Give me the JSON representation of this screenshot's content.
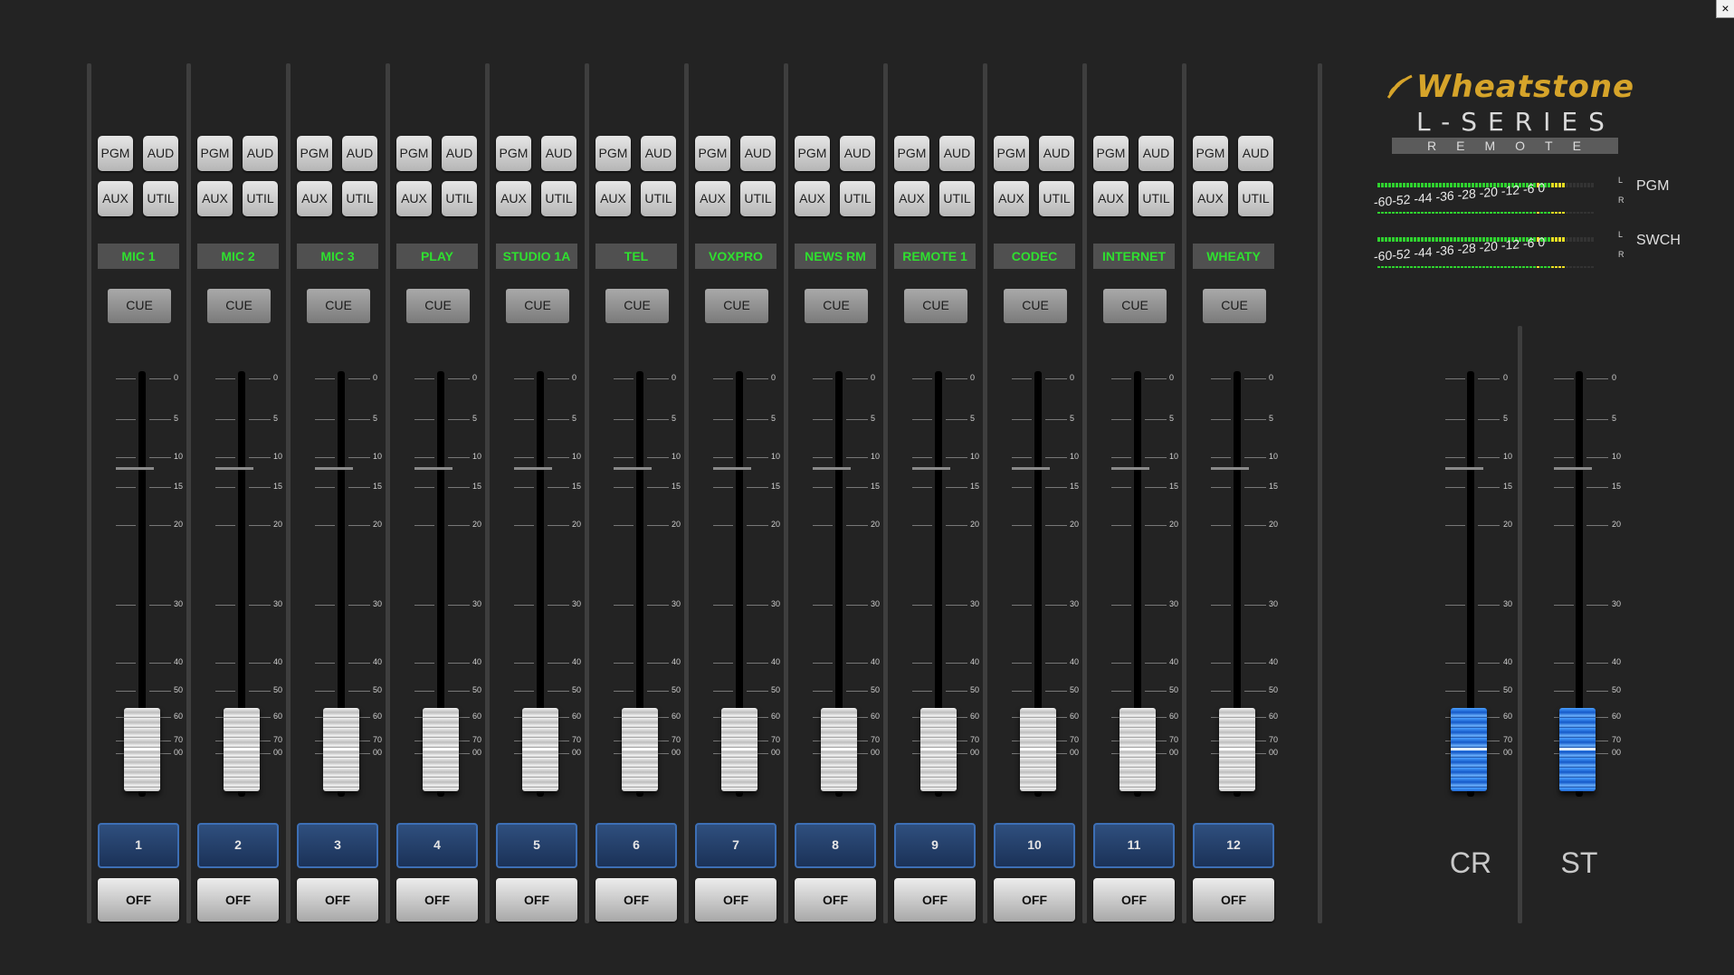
{
  "window": {
    "close_label": "×"
  },
  "logo": {
    "brand": "Wheatstone",
    "series": "L-SERIES",
    "subtitle": "REMOTE"
  },
  "meters": [
    {
      "name": "PGM",
      "scale": "-60-52 -44 -36 -28 -20 -12 -6 0",
      "left": "L",
      "right": "R"
    },
    {
      "name": "SWCH",
      "scale": "-60-52 -44 -36 -28 -20 -12 -6 0",
      "left": "L",
      "right": "R"
    }
  ],
  "fader_scale": [
    "0",
    "5",
    "10",
    "15",
    "20",
    "30",
    "40",
    "50",
    "60",
    "70",
    "00"
  ],
  "channels": [
    {
      "number": "1",
      "label": "MIC 1",
      "pgm": "PGM",
      "aud": "AUD",
      "aux": "AUX",
      "util": "UTIL",
      "cue": "CUE",
      "off": "OFF"
    },
    {
      "number": "2",
      "label": "MIC 2",
      "pgm": "PGM",
      "aud": "AUD",
      "aux": "AUX",
      "util": "UTIL",
      "cue": "CUE",
      "off": "OFF"
    },
    {
      "number": "3",
      "label": "MIC 3",
      "pgm": "PGM",
      "aud": "AUD",
      "aux": "AUX",
      "util": "UTIL",
      "cue": "CUE",
      "off": "OFF"
    },
    {
      "number": "4",
      "label": "PLAY",
      "pgm": "PGM",
      "aud": "AUD",
      "aux": "AUX",
      "util": "UTIL",
      "cue": "CUE",
      "off": "OFF"
    },
    {
      "number": "5",
      "label": "STUDIO 1A",
      "pgm": "PGM",
      "aud": "AUD",
      "aux": "AUX",
      "util": "UTIL",
      "cue": "CUE",
      "off": "OFF"
    },
    {
      "number": "6",
      "label": "TEL",
      "pgm": "PGM",
      "aud": "AUD",
      "aux": "AUX",
      "util": "UTIL",
      "cue": "CUE",
      "off": "OFF"
    },
    {
      "number": "7",
      "label": "VOXPRO",
      "pgm": "PGM",
      "aud": "AUD",
      "aux": "AUX",
      "util": "UTIL",
      "cue": "CUE",
      "off": "OFF"
    },
    {
      "number": "8",
      "label": "NEWS RM",
      "pgm": "PGM",
      "aud": "AUD",
      "aux": "AUX",
      "util": "UTIL",
      "cue": "CUE",
      "off": "OFF"
    },
    {
      "number": "9",
      "label": "REMOTE 1",
      "pgm": "PGM",
      "aud": "AUD",
      "aux": "AUX",
      "util": "UTIL",
      "cue": "CUE",
      "off": "OFF"
    },
    {
      "number": "10",
      "label": "CODEC",
      "pgm": "PGM",
      "aud": "AUD",
      "aux": "AUX",
      "util": "UTIL",
      "cue": "CUE",
      "off": "OFF"
    },
    {
      "number": "11",
      "label": "INTERNET",
      "pgm": "PGM",
      "aud": "AUD",
      "aux": "AUX",
      "util": "UTIL",
      "cue": "CUE",
      "off": "OFF"
    },
    {
      "number": "12",
      "label": "WHEATY",
      "pgm": "PGM",
      "aud": "AUD",
      "aux": "AUX",
      "util": "UTIL",
      "cue": "CUE",
      "off": "OFF"
    }
  ],
  "masters": [
    {
      "name": "CR"
    },
    {
      "name": "ST"
    }
  ]
}
